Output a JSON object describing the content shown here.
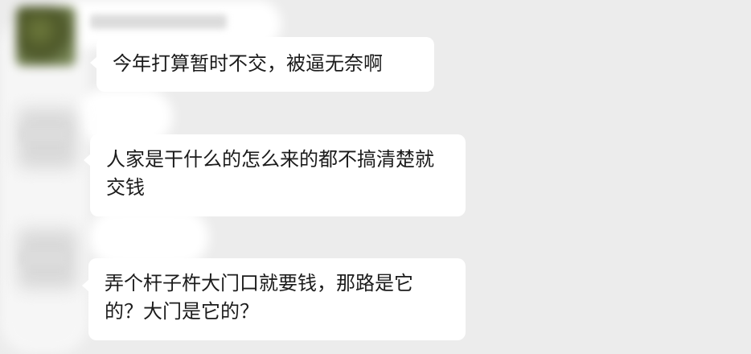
{
  "messages": [
    {
      "text": "今年打算暂时不交，被逼无奈啊"
    },
    {
      "text": "人家是干什么的怎么来的都不搞清楚就交钱"
    },
    {
      "text": "弄个杆子杵大门口就要钱，那路是它的？大门是它的？"
    }
  ],
  "colors": {
    "background": "#ececec",
    "bubble": "#ffffff",
    "text": "#1b1b1b"
  }
}
